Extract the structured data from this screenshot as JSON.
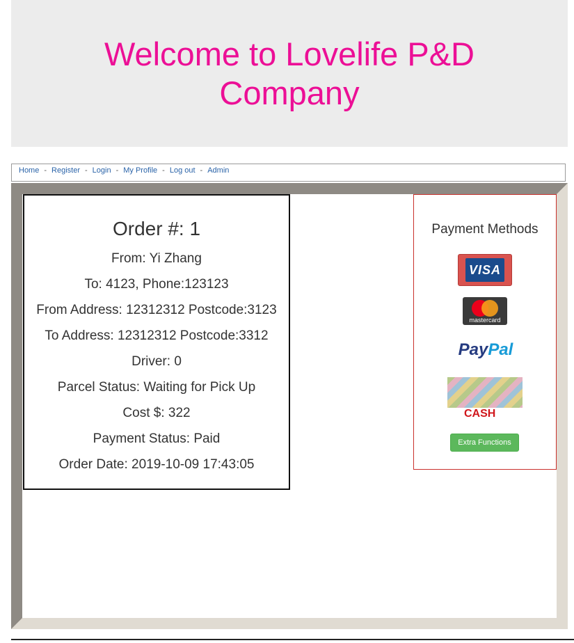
{
  "header": {
    "title": "Welcome to Lovelife P&D Company"
  },
  "nav": {
    "items": [
      "Home",
      "Register",
      "Login",
      "My Profile",
      "Log out",
      "Admin"
    ],
    "separator": "-"
  },
  "order": {
    "title": "Order #: 1",
    "lines": [
      "From: Yi Zhang",
      "To: 4123, Phone:123123",
      "From Address: 12312312 Postcode:3123",
      "To Address: 12312312 Postcode:3312",
      "Driver: 0",
      "Parcel Status: Waiting for Pick Up",
      "Cost $: 322",
      "Payment Status: Paid",
      "Order Date: 2019-10-09 17:43:05"
    ]
  },
  "payment": {
    "title": "Payment Methods",
    "visa_label": "VISA",
    "mastercard_label": "mastercard",
    "paypal_part1": "Pay",
    "paypal_part2": "Pal",
    "cash_label": "CASH",
    "extra_button": "Extra Functions"
  },
  "colors": {
    "title": "#ec0f96",
    "link": "#2a63a8",
    "button_danger": "#d9534f",
    "button_success": "#5cb85c"
  },
  "icons": [
    "visa-card-icon",
    "mastercard-icon",
    "paypal-logo-icon",
    "cash-notes-icon"
  ]
}
